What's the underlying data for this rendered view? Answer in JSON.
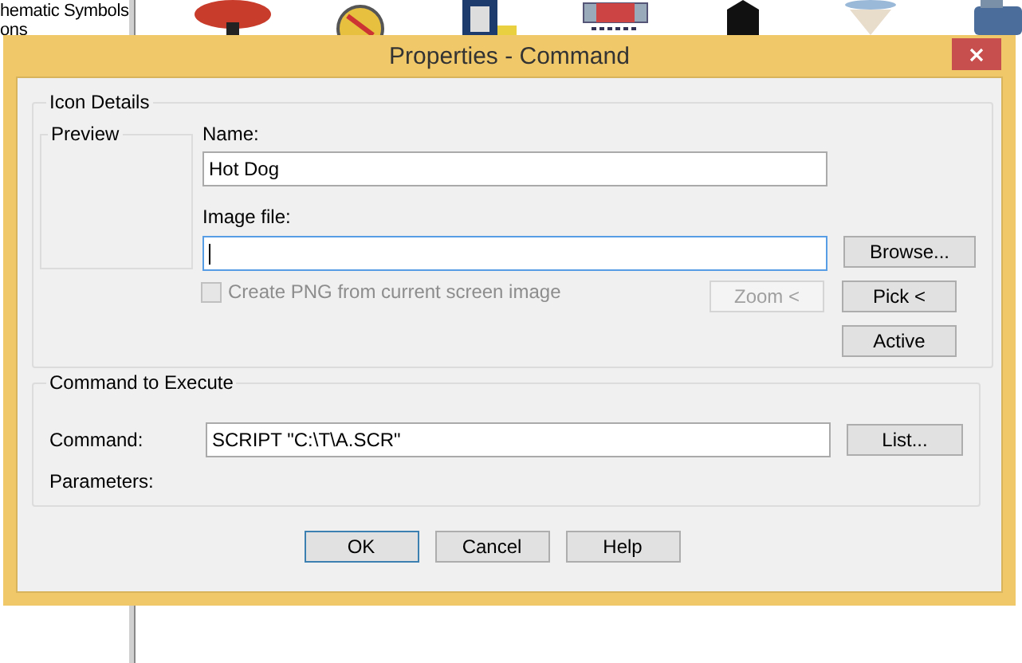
{
  "background": {
    "sidebar_items": [
      "hematic Symbols",
      "ons"
    ]
  },
  "dialog": {
    "title": "Properties - Command",
    "icon_details": {
      "legend": "Icon Details",
      "preview_legend": "Preview",
      "name_label": "Name:",
      "name_value": "Hot Dog",
      "image_label": "Image file:",
      "image_focused": true,
      "browse_button": {
        "label": "Browse...",
        "disabled": false
      },
      "checkbox": {
        "label": "Create PNG from current screen image",
        "checked": false,
        "disabled": true
      },
      "zoom_button": {
        "label": "Zoom <",
        "disabled": true
      },
      "pick_button": {
        "label": "Pick <",
        "disabled": false
      },
      "active_button": {
        "label": "Active",
        "disabled": false
      }
    },
    "command_group": {
      "legend": "Command to Execute",
      "command_label": "Command:",
      "command_value": "SCRIPT \"C:\\T\\A.SCR\"",
      "list_button": {
        "label": "List...",
        "disabled": false
      },
      "parameters_label": "Parameters:"
    },
    "buttons": [
      {
        "label": "OK",
        "default": true
      },
      {
        "label": "Cancel",
        "default": false
      },
      {
        "label": "Help",
        "default": false
      }
    ]
  }
}
